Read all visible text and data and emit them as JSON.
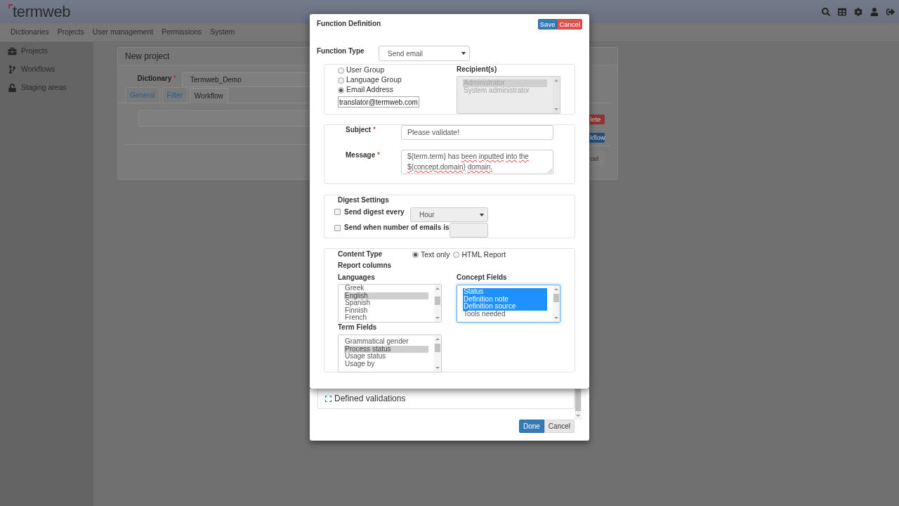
{
  "header": {
    "logo": "termweb"
  },
  "nav": [
    "Dictionaries",
    "Projects",
    "User management",
    "Permissions",
    "System"
  ],
  "sidebar": {
    "items": [
      {
        "label": "Projects"
      },
      {
        "label": "Workflows"
      },
      {
        "label": "Staging areas"
      }
    ]
  },
  "page": {
    "panel_title": "New project",
    "dictionary": {
      "label": "Dictionary",
      "required_mark": "*",
      "value": "Termweb_Demo"
    },
    "tabs": [
      {
        "label": "General",
        "selected": false
      },
      {
        "label": "Filter",
        "selected": false
      },
      {
        "label": "Workflow",
        "selected": true
      }
    ],
    "side_buttons": [
      {
        "label": "lete",
        "kind": "danger"
      },
      {
        "label": "kflow",
        "kind": "primary"
      },
      {
        "label": "cel",
        "kind": "default"
      }
    ]
  },
  "validations_dialog": {
    "section_title": "Defined validations",
    "buttons": [
      {
        "label": "Done",
        "kind": "primary"
      },
      {
        "label": "Cancel",
        "kind": "default"
      }
    ]
  },
  "function_dialog": {
    "title": "Function Definition",
    "buttons": [
      {
        "label": "Save",
        "kind": "primary"
      },
      {
        "label": "Cancel",
        "kind": "danger"
      }
    ],
    "function_type": {
      "label": "Function Type",
      "value": "Send email"
    },
    "recipient_type": {
      "options": [
        {
          "label": "User Group",
          "selected": false
        },
        {
          "label": "Language Group",
          "selected": false
        },
        {
          "label": "Email Address",
          "selected": true
        }
      ],
      "email": "translator@termweb.com"
    },
    "recipients": {
      "label": "Recipient(s)",
      "disabled": true,
      "items": [
        {
          "label": "Administrator",
          "selected": true
        },
        {
          "label": "System administrator",
          "selected": false
        }
      ]
    },
    "subject": {
      "label": "Subject",
      "required_mark": "*",
      "value": "Please validate!"
    },
    "message": {
      "label": "Message",
      "required_mark": "*",
      "words": [
        {
          "text": "${term.term}",
          "misspelled": false
        },
        {
          "text": "has",
          "misspelled": false
        },
        {
          "text": "been",
          "misspelled": true
        },
        {
          "text": "inputted",
          "misspelled": true
        },
        {
          "text": "into",
          "misspelled": true
        },
        {
          "text": "the",
          "misspelled": true
        },
        {
          "text": "${concept.domain}",
          "misspelled": true
        },
        {
          "text": "domain.",
          "misspelled": true
        }
      ]
    },
    "digest": {
      "title": "Digest Settings",
      "rows": [
        {
          "kind": "select",
          "label": "Send digest every",
          "checked": false,
          "disabled": true,
          "value": "Hour"
        },
        {
          "kind": "input",
          "label": "Send when number of emails is",
          "checked": false,
          "disabled": true
        }
      ]
    },
    "content_type": {
      "label": "Content Type",
      "options": [
        {
          "label": "Text only",
          "selected": true
        },
        {
          "label": "HTML Report",
          "selected": false
        }
      ]
    },
    "report_columns": {
      "title": "Report columns",
      "lists": [
        {
          "label": "Languages",
          "focused": false,
          "items": [
            {
              "label": "Greek",
              "selected": false
            },
            {
              "label": "English",
              "selected": true
            },
            {
              "label": "Spanish",
              "selected": false
            },
            {
              "label": "Finnish",
              "selected": false
            },
            {
              "label": "French",
              "selected": false
            }
          ]
        },
        {
          "label": "Concept Fields",
          "focused": true,
          "items": [
            {
              "label": "Status",
              "selected": true
            },
            {
              "label": "Definition note",
              "selected": true
            },
            {
              "label": "Definition source",
              "selected": true
            },
            {
              "label": "Tools needed",
              "selected": false
            }
          ]
        },
        {
          "label": "Term Fields",
          "focused": false,
          "items": [
            {
              "label": "Grammatical gender",
              "selected": false
            },
            {
              "label": "Process status",
              "selected": true
            },
            {
              "label": "Usage status",
              "selected": false
            },
            {
              "label": "Usage by",
              "selected": false
            }
          ]
        }
      ]
    }
  }
}
